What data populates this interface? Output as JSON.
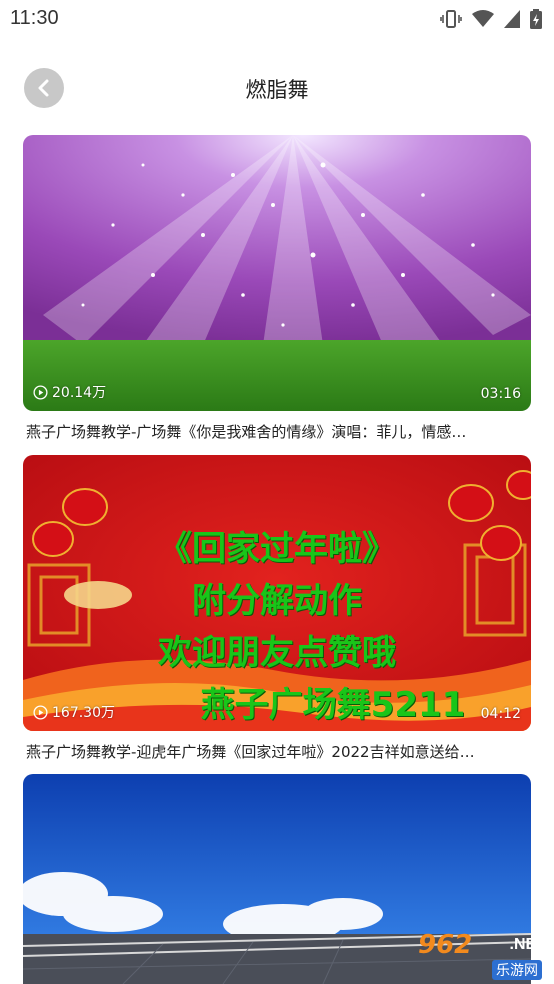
{
  "status_bar": {
    "time": "11:30"
  },
  "header": {
    "title": "燃脂舞",
    "back_icon": "chevron-left-icon"
  },
  "videos": [
    {
      "views": "20.14万",
      "duration": "03:16",
      "title": "燕子广场舞教学-广场舞《你是我难舍的情缘》演唱：菲儿，情感…"
    },
    {
      "views": "167.30万",
      "duration": "04:12",
      "title": "燕子广场舞教学-迎虎年广场舞《回家过年啦》2022吉祥如意送给…",
      "overlay_lines": [
        "《回家过年啦》",
        "附分解动作",
        "欢迎朋友点赞哦",
        "燕子广场舞5211"
      ]
    },
    {
      "views": "",
      "duration": "",
      "title": ""
    }
  ],
  "watermark": {
    "number": "962",
    "suffix": ".NET",
    "site": "乐游网"
  },
  "colors": {
    "overlay_green": "#19c519",
    "festive_red": "#d8141a"
  }
}
